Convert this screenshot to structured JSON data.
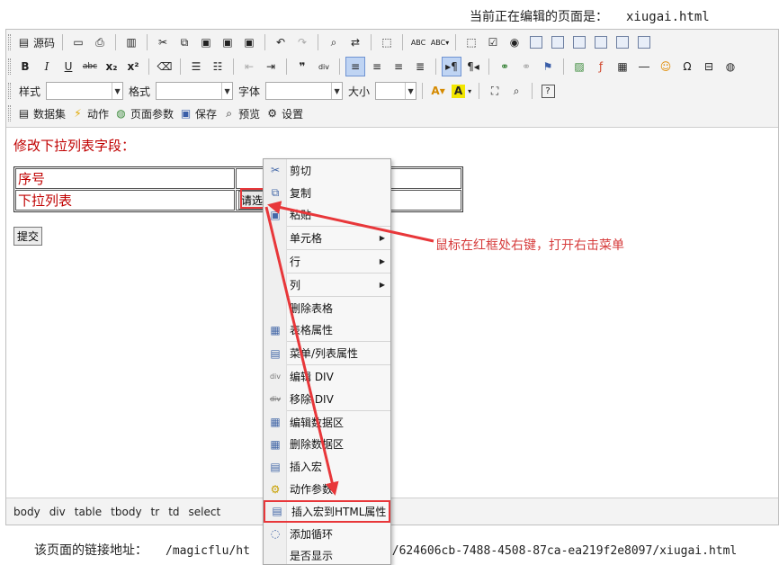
{
  "header": {
    "label": "当前正在编辑的页面是：",
    "filename": "xiugai.html"
  },
  "toolbar": {
    "row1": [
      {
        "icon": "source-icon",
        "label": "源码"
      },
      {
        "icon": "new-page-icon",
        "label": ""
      },
      {
        "icon": "print-icon",
        "label": ""
      },
      {
        "icon": "preview-doc-icon",
        "label": ""
      },
      {
        "icon": "cut-icon",
        "label": ""
      },
      {
        "icon": "copy-icon",
        "label": ""
      },
      {
        "icon": "paste-icon",
        "label": ""
      },
      {
        "icon": "paste-text-icon",
        "label": ""
      },
      {
        "icon": "paste-word-icon",
        "label": ""
      },
      {
        "icon": "undo-icon",
        "label": ""
      },
      {
        "icon": "redo-icon",
        "label": ""
      },
      {
        "icon": "find-icon",
        "label": ""
      },
      {
        "icon": "replace-icon",
        "label": ""
      },
      {
        "icon": "select-all-icon",
        "label": ""
      },
      {
        "icon": "spellcheck-icon",
        "label": ""
      },
      {
        "icon": "spellcheck-dropdown-icon",
        "label": ""
      }
    ],
    "row3": {
      "style_label": "样式",
      "format_label": "格式",
      "font_label": "字体",
      "size_label": "大小"
    },
    "row4": [
      {
        "icon": "dataset-icon",
        "label": "数据集"
      },
      {
        "icon": "action-icon",
        "label": "动作"
      },
      {
        "icon": "page-params-icon",
        "label": "页面参数"
      },
      {
        "icon": "save-icon",
        "label": "保存"
      },
      {
        "icon": "preview-icon",
        "label": "预览"
      },
      {
        "icon": "settings-icon",
        "label": "设置"
      }
    ]
  },
  "content": {
    "caption": "修改下拉列表字段：",
    "rows": [
      {
        "label": "序号",
        "value": ""
      },
      {
        "label": "下拉列表",
        "value": "请选"
      }
    ],
    "submit_label": "提交"
  },
  "statusbar": {
    "path": [
      "body",
      "div",
      "table",
      "tbody",
      "tr",
      "td",
      "select"
    ]
  },
  "footer": {
    "label": "该页面的链接地址：",
    "url_start": "/magicflu/ht",
    "url_end": "s/624606cb-7488-4508-87ca-ea219f2e8097/xiugai.html"
  },
  "context_menu": {
    "items": [
      {
        "label": "剪切",
        "icon": "cut-icon"
      },
      {
        "label": "复制",
        "icon": "copy-icon"
      },
      {
        "label": "粘贴",
        "icon": "paste-icon"
      },
      {
        "label": "单元格",
        "icon": "",
        "submenu": true
      },
      {
        "label": "行",
        "icon": "",
        "submenu": true
      },
      {
        "label": "列",
        "icon": "",
        "submenu": true
      },
      {
        "label": "删除表格",
        "icon": ""
      },
      {
        "label": "表格属性",
        "icon": "table-icon"
      },
      {
        "label": "菜单/列表属性",
        "icon": "list-properties-icon"
      },
      {
        "label": "编辑 DIV",
        "icon": "div-icon"
      },
      {
        "label": "移除 DIV",
        "icon": "div-remove-icon"
      },
      {
        "label": "编辑数据区",
        "icon": "dataregion-edit-icon"
      },
      {
        "label": "删除数据区",
        "icon": "dataregion-delete-icon"
      },
      {
        "label": "插入宏",
        "icon": "macro-icon"
      },
      {
        "label": "动作参数",
        "icon": "action-params-icon"
      },
      {
        "label": "插入宏到HTML属性",
        "icon": "macro-html-icon",
        "highlighted": true
      },
      {
        "label": "添加循环",
        "icon": "loop-icon"
      },
      {
        "label": "是否显示",
        "icon": ""
      }
    ]
  },
  "annotation": {
    "text": "鼠标在红框处右键，打开右击菜单",
    "color": "#d63b3b"
  },
  "colors": {
    "accent_red": "#e8373a",
    "field_text": "#c00000"
  }
}
